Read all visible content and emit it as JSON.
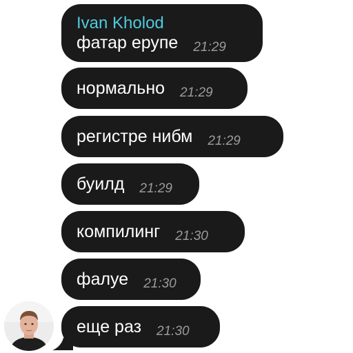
{
  "chat": {
    "author": "Ivan Kholod",
    "messages": [
      {
        "text": "фатар ерупе",
        "time": "21:29"
      },
      {
        "text": "нормально",
        "time": "21:29"
      },
      {
        "text": "регистре нибм",
        "time": "21:29"
      },
      {
        "text": "буилд",
        "time": "21:29"
      },
      {
        "text": "компилинг",
        "time": "21:30"
      },
      {
        "text": "фалуе",
        "time": "21:30"
      },
      {
        "text": "еще раз",
        "time": "21:30"
      }
    ]
  },
  "colors": {
    "bubble": "#1a1a1a",
    "author": "#4ecbde",
    "message_text": "#ffffff",
    "timestamp": "#9b9b9b"
  },
  "icons": {
    "avatar": "user-avatar-photo"
  }
}
